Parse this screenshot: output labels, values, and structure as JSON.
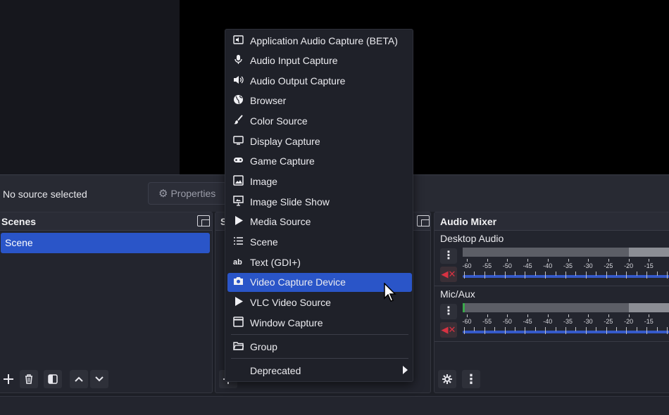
{
  "context_bar": {
    "no_source_text": "No source selected",
    "properties_label": "Properties"
  },
  "scenes": {
    "title": "Scenes",
    "items": [
      "Scene"
    ]
  },
  "sources": {
    "title_visible": "S"
  },
  "mixer": {
    "title": "Audio Mixer",
    "channels": [
      {
        "name": "Desktop Audio"
      },
      {
        "name": "Mic/Aux"
      }
    ],
    "scale_labels": [
      "-60",
      "-55",
      "-50",
      "-45",
      "-40",
      "-35",
      "-30",
      "-25",
      "-20",
      "-15"
    ]
  },
  "add_source_menu": {
    "items": [
      {
        "label": "Application Audio Capture (BETA)",
        "icon": "app-audio-icon"
      },
      {
        "label": "Audio Input Capture",
        "icon": "microphone-icon"
      },
      {
        "label": "Audio Output Capture",
        "icon": "speaker-icon"
      },
      {
        "label": "Browser",
        "icon": "globe-icon"
      },
      {
        "label": "Color Source",
        "icon": "brush-icon"
      },
      {
        "label": "Display Capture",
        "icon": "monitor-icon"
      },
      {
        "label": "Game Capture",
        "icon": "gamepad-icon"
      },
      {
        "label": "Image",
        "icon": "image-icon"
      },
      {
        "label": "Image Slide Show",
        "icon": "slideshow-icon"
      },
      {
        "label": "Media Source",
        "icon": "play-icon"
      },
      {
        "label": "Scene",
        "icon": "list-icon"
      },
      {
        "label": "Text (GDI+)",
        "icon": "text-icon"
      },
      {
        "label": "Video Capture Device",
        "icon": "camera-icon"
      },
      {
        "label": "VLC Video Source",
        "icon": "play-icon"
      },
      {
        "label": "Window Capture",
        "icon": "window-icon"
      }
    ],
    "group_label": "Group",
    "deprecated_label": "Deprecated",
    "selected_index": 12
  },
  "colors": {
    "accent": "#2a55c8",
    "mute_red": "#d83242",
    "background": "#1d1f26"
  }
}
